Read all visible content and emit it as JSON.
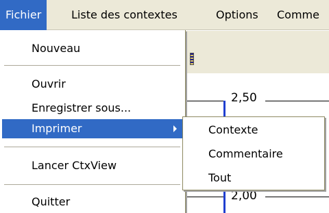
{
  "menubar": {
    "items": [
      "Fichier",
      "Liste des contextes",
      "Options",
      "Comme"
    ]
  },
  "menu": {
    "items": [
      {
        "label": "Nouveau"
      },
      {
        "label": "Ouvrir"
      },
      {
        "label": "Enregistrer sous..."
      },
      {
        "label": "Imprimer"
      },
      {
        "label": "Lancer CtxView"
      },
      {
        "label": "Quitter"
      }
    ]
  },
  "submenu": {
    "items": [
      {
        "label": "Contexte"
      },
      {
        "label": "Commentaire"
      },
      {
        "label": "Tout"
      }
    ]
  },
  "canvas": {
    "scale_labels": [
      "2,50",
      "2,00"
    ]
  },
  "colors": {
    "highlight": "#316ac5",
    "menubar_bg": "#ece9d8",
    "scale_blue": "#1f3fd0"
  }
}
